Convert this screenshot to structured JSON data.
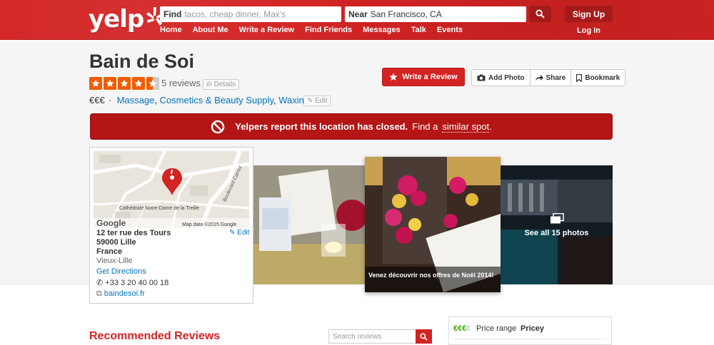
{
  "header": {
    "logo_text": "yelp",
    "find_label": "Find",
    "find_placeholder": "tacos, cheap dinner, Max's",
    "near_label": "Near",
    "near_value": "San Francisco, CA",
    "nav": [
      "Home",
      "About Me",
      "Write a Review",
      "Find Friends",
      "Messages",
      "Talk",
      "Events"
    ],
    "signup": "Sign Up",
    "login": "Log In",
    "brand_color": "#d32323"
  },
  "business": {
    "name": "Bain de Soi",
    "rating": 4.5,
    "review_count": "5 reviews",
    "details": "Details",
    "price": "€€€",
    "categories": [
      "Massage",
      "Cosmetics & Beauty Supply",
      "Waxing"
    ],
    "edit": "Edit"
  },
  "actions": {
    "write_review": "Write a Review",
    "add_photo": "Add Photo",
    "share": "Share",
    "bookmark": "Bookmark"
  },
  "alert": {
    "bold": "Yelpers report this location has closed.",
    "rest": "Find a",
    "link": "similar spot",
    "end": "."
  },
  "location": {
    "street": "12 ter rue des Tours",
    "postal": "59000 Lille",
    "country": "France",
    "area": "Vieux-Lille",
    "directions": "Get Directions",
    "phone": "+33 3 20 40 00 18",
    "website": "baindesoi.fr",
    "edit": "Edit",
    "map_label_cathedral": "Cathédrale Notre-Dame de la Treille",
    "map_label_road": "Boulevard Carnot",
    "map_credit": "Map data ©2015 Google",
    "map_logo": "Google"
  },
  "photos": {
    "caption": "Venez découvrir nos offres de Noël 2014!",
    "see_all": "See all 15 photos"
  },
  "reviews": {
    "title": "Recommended Reviews",
    "search_placeholder": "Search reviews"
  },
  "sidebar": {
    "price_symbol_on": "€€€",
    "price_symbol_off": "€",
    "price_range_label": "Price range",
    "price_range_value": "Pricey"
  }
}
